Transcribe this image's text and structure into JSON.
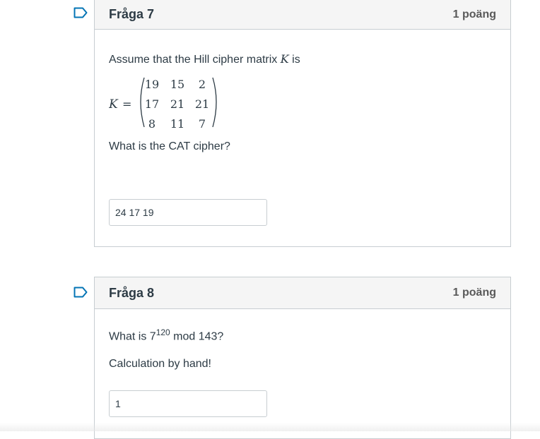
{
  "questions": [
    {
      "title": "Fråga 7",
      "points": "1 poäng",
      "prompt": "Assume that the Hill cipher matrix ",
      "prompt_var": "K",
      "prompt_end": " is",
      "matrix_label": "K",
      "matrix_eq": "=",
      "matrix": [
        [
          "19",
          "15",
          "2"
        ],
        [
          "17",
          "21",
          "21"
        ],
        [
          "8",
          "11",
          "7"
        ]
      ],
      "question": "What is the CAT cipher?",
      "answer": "24 17 19"
    },
    {
      "title": "Fråga 8",
      "points": "1 poäng",
      "prompt_base": "What is 7",
      "prompt_exp": "120",
      "prompt_rest": " mod 143?",
      "note": "Calculation by hand!",
      "answer": "1"
    }
  ],
  "colors": {
    "accent": "#0374b5",
    "border": "#c7cdd1",
    "header_bg": "#f5f5f5"
  }
}
